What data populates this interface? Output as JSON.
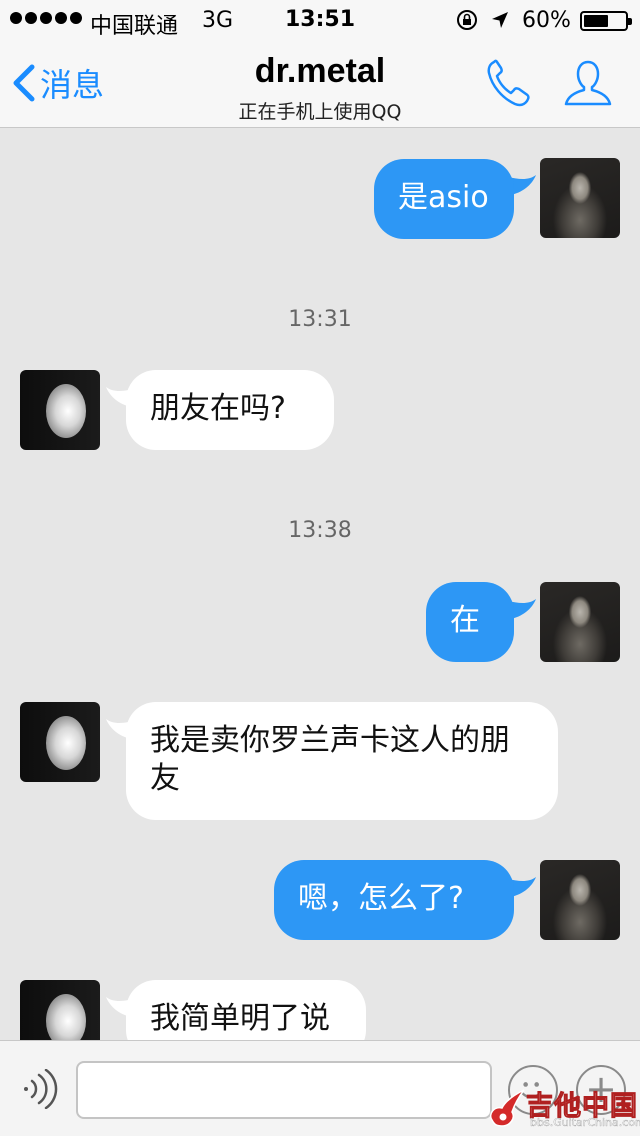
{
  "status_bar": {
    "carrier": "中国联通",
    "network": "3G",
    "time": "13:51",
    "battery": "60%",
    "battery_level": 0.6
  },
  "nav": {
    "back_label": "消息",
    "title": "dr.metal",
    "subtitle": "正在手机上使用QQ"
  },
  "messages": [
    {
      "from": "me",
      "text": "是asio"
    },
    {
      "time": "13:31"
    },
    {
      "from": "friend",
      "text": "朋友在吗?"
    },
    {
      "time": "13:38"
    },
    {
      "from": "me",
      "text": "在"
    },
    {
      "from": "friend",
      "text": "我是卖你罗兰声卡这人的朋友"
    },
    {
      "from": "me",
      "text": "嗯，怎么了?"
    },
    {
      "from": "friend",
      "text": "我简单明了说"
    }
  ],
  "input": {
    "value": "",
    "placeholder": ""
  },
  "watermark": {
    "text": "吉他中国",
    "url": "bbs.GuitarChina.com"
  },
  "colors": {
    "accent": "#1a8cff",
    "outgoing_bubble": "#2d97f5",
    "incoming_bubble": "#ffffff",
    "chat_background": "#e6e6e6"
  }
}
